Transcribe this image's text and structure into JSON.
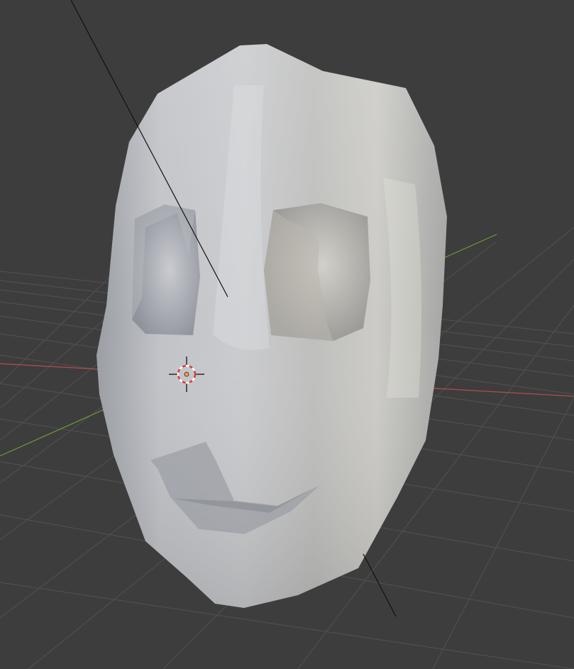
{
  "viewport": {
    "background": "#3d3d3d",
    "grid_color": "#4e4e4e",
    "x_axis_color": "#b44c55",
    "y_axis_color": "#6c9a3a",
    "mesh_color": "#c4c6cb",
    "camera_line_color": "#111111"
  },
  "scene": {
    "object": "face-mask-mesh",
    "cursor_icon": "3d-cursor-icon",
    "origin_icon": "object-origin-icon"
  }
}
